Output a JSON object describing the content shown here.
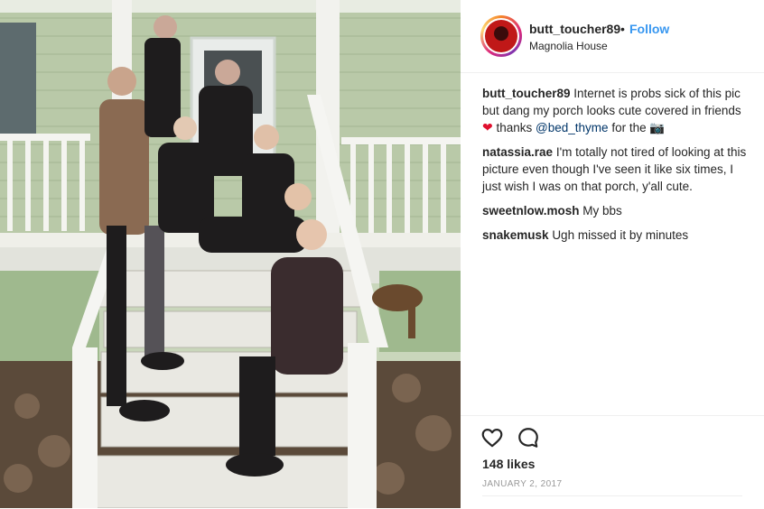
{
  "post": {
    "photo_alt": "",
    "header": {
      "username": "butt_toucher89",
      "separator": "•",
      "follow_label": "Follow",
      "location": "Magnolia House"
    },
    "comments": [
      {
        "author": "butt_toucher89",
        "text_before": "Internet is probs sick of this pic but dang my porch looks cute covered in friends",
        "emoji_heart": "❤",
        "text_mid": "thanks",
        "mention": "@bed_thyme",
        "text_after": "for the",
        "emoji_camera": "📷"
      },
      {
        "author": "natassia.rae",
        "text": "I'm totally not tired of looking at this picture even though I've seen it like six times, I just wish I was on that porch, y'all cute."
      },
      {
        "author": "sweetnlow.mosh",
        "text": "My bbs"
      },
      {
        "author": "snakemusk",
        "text": "Ugh missed it by minutes"
      }
    ],
    "actions": {
      "like_icon": "heart-outline-icon",
      "comment_icon": "speech-bubble-icon",
      "likes_text": "148 likes",
      "date_text": "JANUARY 2, 2017"
    }
  },
  "colors": {
    "link_blue": "#3897f0",
    "mention_blue": "#003569",
    "text": "#262626",
    "muted": "#999999",
    "border": "#efefef",
    "heart_red": "#e0102e"
  }
}
